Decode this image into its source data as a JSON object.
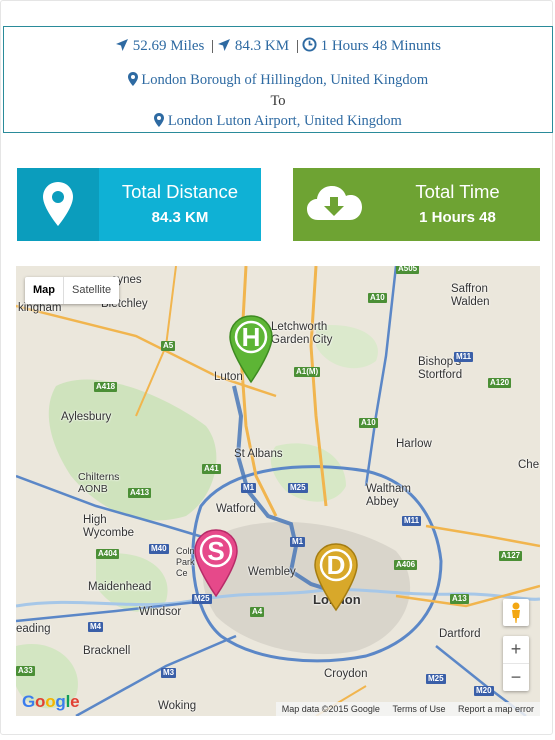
{
  "route": {
    "miles": "52.69 Miles",
    "km": "84.3 KM",
    "duration": "1 Hours 48 Minunts",
    "separator": "|",
    "origin": "London Borough of Hillingdon, United Kingdom",
    "to_label": "To",
    "destination": "London Luton Airport, United Kingdom"
  },
  "tiles": {
    "distance": {
      "title": "Total Distance",
      "value": "84.3 KM",
      "icon": "map-pin-icon",
      "color": "#0fb1d5"
    },
    "time": {
      "title": "Total Time",
      "value": "1 Hours 48",
      "icon": "cloud-download-icon",
      "color": "#6ea333"
    }
  },
  "map": {
    "type_map": "Map",
    "type_satellite": "Satellite",
    "zoom_in": "+",
    "zoom_out": "−",
    "google": "Google",
    "attribution": "Map data ©2015 Google",
    "terms": "Terms of Use",
    "report": "Report a map error",
    "markers": {
      "start": "S",
      "waypoint": "H",
      "destination": "D"
    },
    "places": {
      "eynes": "eynes",
      "bletchley": "Bletchley",
      "kingham": "kingham",
      "letchworth": "Letchworth Garden City",
      "saffron": "Saffron Walden",
      "luton": "Luton",
      "bishops": "Bishop's Stortford",
      "aylesbury": "Aylesbury",
      "harlow": "Harlow",
      "stalbans": "St Albans",
      "chilterns": "Chilterns AONB",
      "waltham": "Waltham Abbey",
      "che": "Che",
      "watford": "Watford",
      "highwycombe": "High Wycombe",
      "maidenhead": "Maidenhead",
      "windsor": "Windsor",
      "wembley": "Wembley",
      "london": "London",
      "eading": "eading",
      "dartford": "Dartford",
      "bracknell": "Bracknell",
      "croydon": "Croydon",
      "woking": "Woking",
      "colne": "Colne Park Ce"
    },
    "roads": {
      "a505": "A505",
      "a10": "A10",
      "a5": "A5",
      "a1m": "A1(M)",
      "m11a": "M11",
      "a418": "A418",
      "a120": "A120",
      "a10b": "A10",
      "a41": "A41",
      "m1": "M1",
      "m25a": "M25",
      "a413": "A413",
      "m11b": "M11",
      "m40": "M40",
      "a404": "A404",
      "m1b": "M1",
      "a406": "A406",
      "a127": "A127",
      "m25b": "M25",
      "a4": "A4",
      "a13": "A13",
      "m4": "M4",
      "m3": "M3",
      "a33": "A33",
      "m20": "M20",
      "m25c": "M25"
    }
  }
}
